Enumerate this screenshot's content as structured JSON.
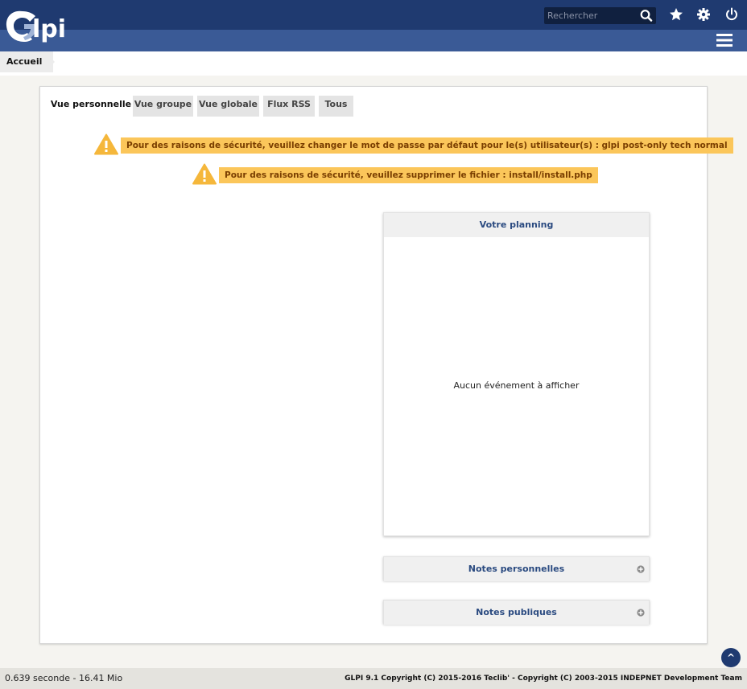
{
  "app": {
    "logo_text": "Glpi"
  },
  "header": {
    "search_placeholder": "Rechercher",
    "icons": [
      "search-icon",
      "star-icon",
      "gear-icon",
      "power-icon",
      "menu-icon"
    ]
  },
  "breadcrumb": {
    "home": "Accueil"
  },
  "tabs": [
    {
      "label": "Vue personnelle",
      "active": true
    },
    {
      "label": "Vue groupe",
      "active": false
    },
    {
      "label": "Vue globale",
      "active": false
    },
    {
      "label": "Flux RSS",
      "active": false
    },
    {
      "label": "Tous",
      "active": false
    }
  ],
  "alerts": [
    {
      "text": "Pour des raisons de sécurité, veuillez changer le mot de passe par défaut pour le(s) utilisateur(s) : glpi post-only tech normal"
    },
    {
      "text": "Pour des raisons de sécurité, veuillez supprimer le fichier : install/install.php"
    }
  ],
  "planning": {
    "title": "Votre planning",
    "empty_text": "Aucun événement à afficher"
  },
  "notes": {
    "personal_title": "Notes personnelles",
    "public_title": "Notes publiques"
  },
  "footer": {
    "timing": "0.639 seconde - 16.41 Mio",
    "copyright": "GLPI 9.1 Copyright (C) 2015-2016 Teclib' - Copyright (C) 2003-2015 INDEPNET Development Team",
    "scroll_top": "^"
  },
  "colors": {
    "header_dark": "#1f3a70",
    "header_light": "#3a5a96",
    "alert_bg": "#fbc65a",
    "alert_icon": "#f5b73b",
    "box_title": "#2a4a80"
  }
}
